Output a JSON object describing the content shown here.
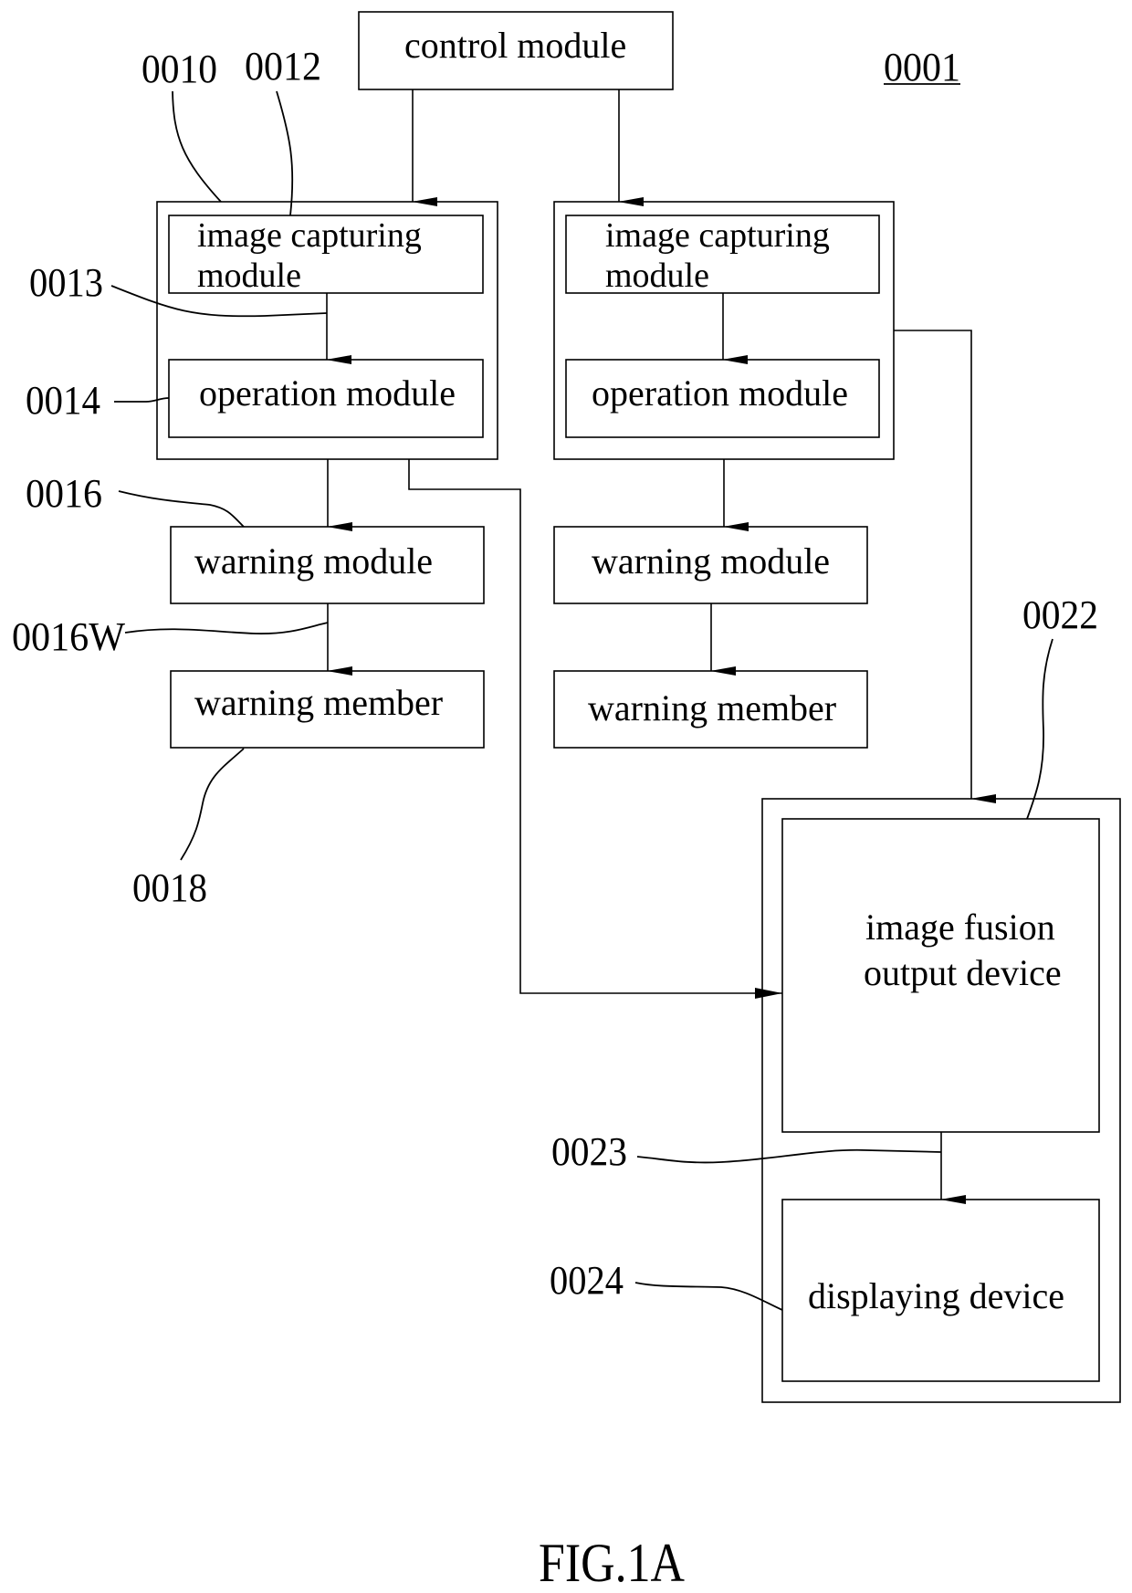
{
  "figure": {
    "caption": "FIG.1A",
    "system_ref": "0001"
  },
  "blocks": {
    "control_module": "control module",
    "left_image_capturing": [
      "image capturing",
      "module"
    ],
    "left_operation": "operation module",
    "left_warning_module": "warning module",
    "left_warning_member": "warning member",
    "right_image_capturing": [
      "image capturing",
      "module"
    ],
    "right_operation": "operation module",
    "right_warning_module": "warning module",
    "right_warning_member": "warning member",
    "image_fusion": [
      "image fusion",
      "output device"
    ],
    "displaying_device": "displaying device"
  },
  "reference_numerals": {
    "lens_group": "0010",
    "image_capturing": "0012",
    "image_signal": "0013",
    "operation": "0014",
    "warning_module": "0016",
    "warning_signal": "0016W",
    "warning_member": "0018",
    "fusion_device": "0022",
    "fusion_signal": "0023",
    "display": "0024"
  },
  "colors": {
    "line": "#000000",
    "background": "#ffffff"
  }
}
